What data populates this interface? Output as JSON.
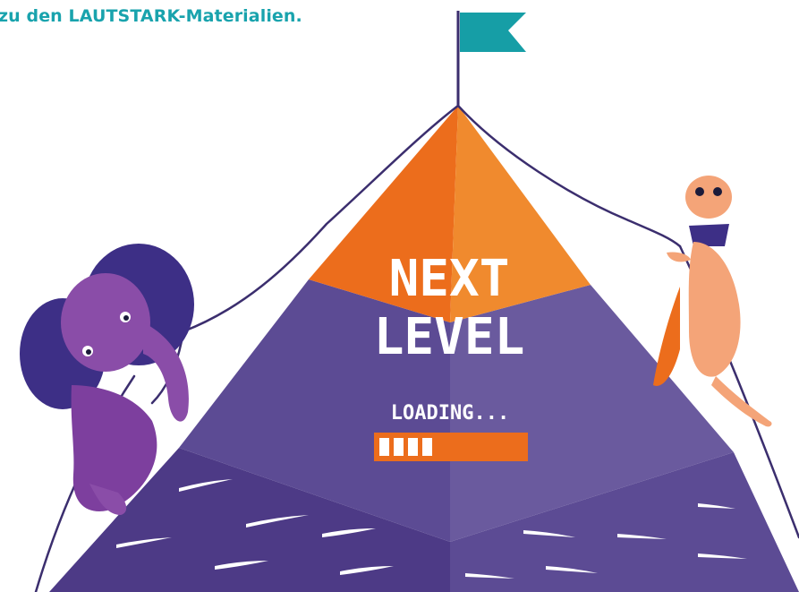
{
  "header": {
    "text": "zu den LAUTSTARK-Materialien."
  },
  "hero": {
    "title_line_1": "NEXT",
    "title_line_2": "LEVEL",
    "loading_label": "LOADING...",
    "progress_filled_segments": 4
  },
  "icons": [
    "flag-icon",
    "elephant-character",
    "meerkat-character"
  ],
  "colors": {
    "header_text": "#19a3ad",
    "flag": "#169ea6",
    "orange": "#ec6d1c",
    "orange_light": "#f08a2e",
    "purple_dark": "#4d3a86",
    "purple_mid": "#5c4b94",
    "purple_light": "#6a5a9e",
    "rope": "#3b2e6e"
  }
}
